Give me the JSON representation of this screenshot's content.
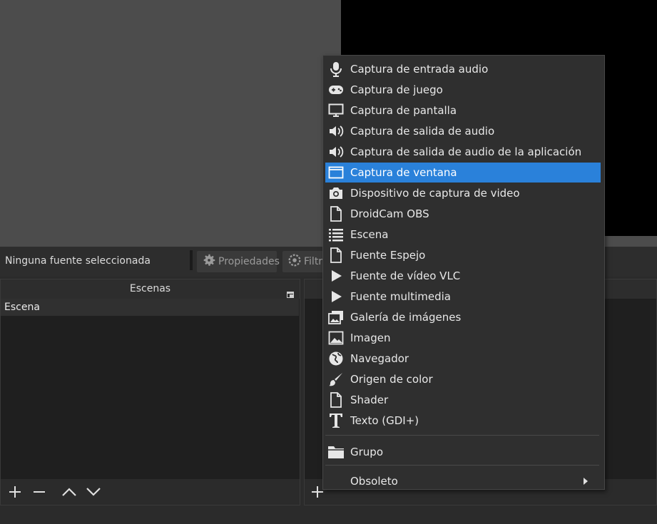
{
  "toolbar": {
    "status": "Ninguna fuente seleccionada",
    "properties_label": "Propiedades",
    "filters_label": "Filtros"
  },
  "scenes_dock": {
    "title": "Escenas",
    "items": [
      "Escena"
    ]
  },
  "context_menu": {
    "items": [
      {
        "label": "Captura de entrada audio",
        "icon": "microphone-icon"
      },
      {
        "label": "Captura de juego",
        "icon": "gamepad-icon"
      },
      {
        "label": "Captura de pantalla",
        "icon": "monitor-icon"
      },
      {
        "label": "Captura de salida de audio",
        "icon": "speaker-icon"
      },
      {
        "label": "Captura de salida de audio de la aplicación",
        "icon": "speaker-icon"
      },
      {
        "label": "Captura de ventana",
        "icon": "window-icon",
        "selected": true
      },
      {
        "label": "Dispositivo de captura de video",
        "icon": "camera-icon"
      },
      {
        "label": "DroidCam OBS",
        "icon": "file-icon"
      },
      {
        "label": "Escena",
        "icon": "list-icon"
      },
      {
        "label": "Fuente Espejo",
        "icon": "file-icon"
      },
      {
        "label": "Fuente de vídeo VLC",
        "icon": "play-icon"
      },
      {
        "label": "Fuente multimedia",
        "icon": "play-icon"
      },
      {
        "label": "Galería de imágenes",
        "icon": "images-icon"
      },
      {
        "label": "Imagen",
        "icon": "image-icon"
      },
      {
        "label": "Navegador",
        "icon": "globe-icon"
      },
      {
        "label": "Origen de color",
        "icon": "brush-icon"
      },
      {
        "label": "Shader",
        "icon": "file-icon"
      },
      {
        "label": "Texto (GDI+)",
        "icon": "text-icon"
      },
      {
        "label": "Grupo",
        "icon": "folder-icon"
      },
      {
        "label": "Obsoleto",
        "icon": "",
        "submenu": true
      }
    ]
  },
  "colors": {
    "selection": "#2a81da",
    "menu_bg": "#2f2f2f",
    "dock_bg": "#1f1f1f"
  }
}
